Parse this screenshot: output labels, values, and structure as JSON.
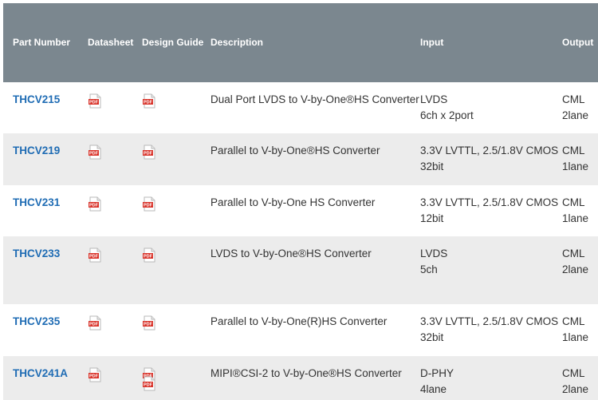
{
  "columns": {
    "part_number": "Part Number",
    "datasheet": "Datasheet",
    "design_guide": "Design Guide",
    "description": "Description",
    "input": "Input",
    "output": "Output"
  },
  "rows": [
    {
      "part": "THCV215",
      "description": "Dual Port LVDS to V-by-One®HS Converter",
      "input": [
        "LVDS",
        "6ch x 2port"
      ],
      "output": [
        "CML",
        "2lane"
      ],
      "design_guides": 1
    },
    {
      "part": "THCV219",
      "description": "Parallel to V-by-One®HS Converter",
      "input": [
        "3.3V LVTTL, 2.5/1.8V CMOS",
        "32bit"
      ],
      "output": [
        "CML",
        "1lane"
      ],
      "design_guides": 1
    },
    {
      "part": "THCV231",
      "description": "Parallel to V-by-One HS Converter",
      "input": [
        "3.3V LVTTL, 2.5/1.8V CMOS",
        "12bit"
      ],
      "output": [
        "CML",
        "1lane"
      ],
      "design_guides": 1
    },
    {
      "part": "THCV233",
      "description": "LVDS to V-by-One®HS Converter",
      "input": [
        "LVDS",
        "5ch"
      ],
      "output": [
        "CML",
        "2lane"
      ],
      "design_guides": 1
    },
    {
      "part": "THCV235",
      "description": "Parallel to V-by-One(R)HS Converter",
      "input": [
        "3.3V LVTTL, 2.5/1.8V CMOS",
        "32bit"
      ],
      "output": [
        "CML",
        "1lane"
      ],
      "design_guides": 1
    },
    {
      "part": "THCV241A",
      "description": "MIPI®CSI-2 to V-by-One®HS Converter",
      "input": [
        "D-PHY",
        "4lane"
      ],
      "output": [
        "CML",
        "2lane"
      ],
      "design_guides": 2
    }
  ],
  "pdf_icon_label": "PDF",
  "colors": {
    "header_bg": "#7b878f",
    "alt_row_bg": "#ececec",
    "link": "#1f6cb4",
    "pdf_red": "#d9342b"
  }
}
